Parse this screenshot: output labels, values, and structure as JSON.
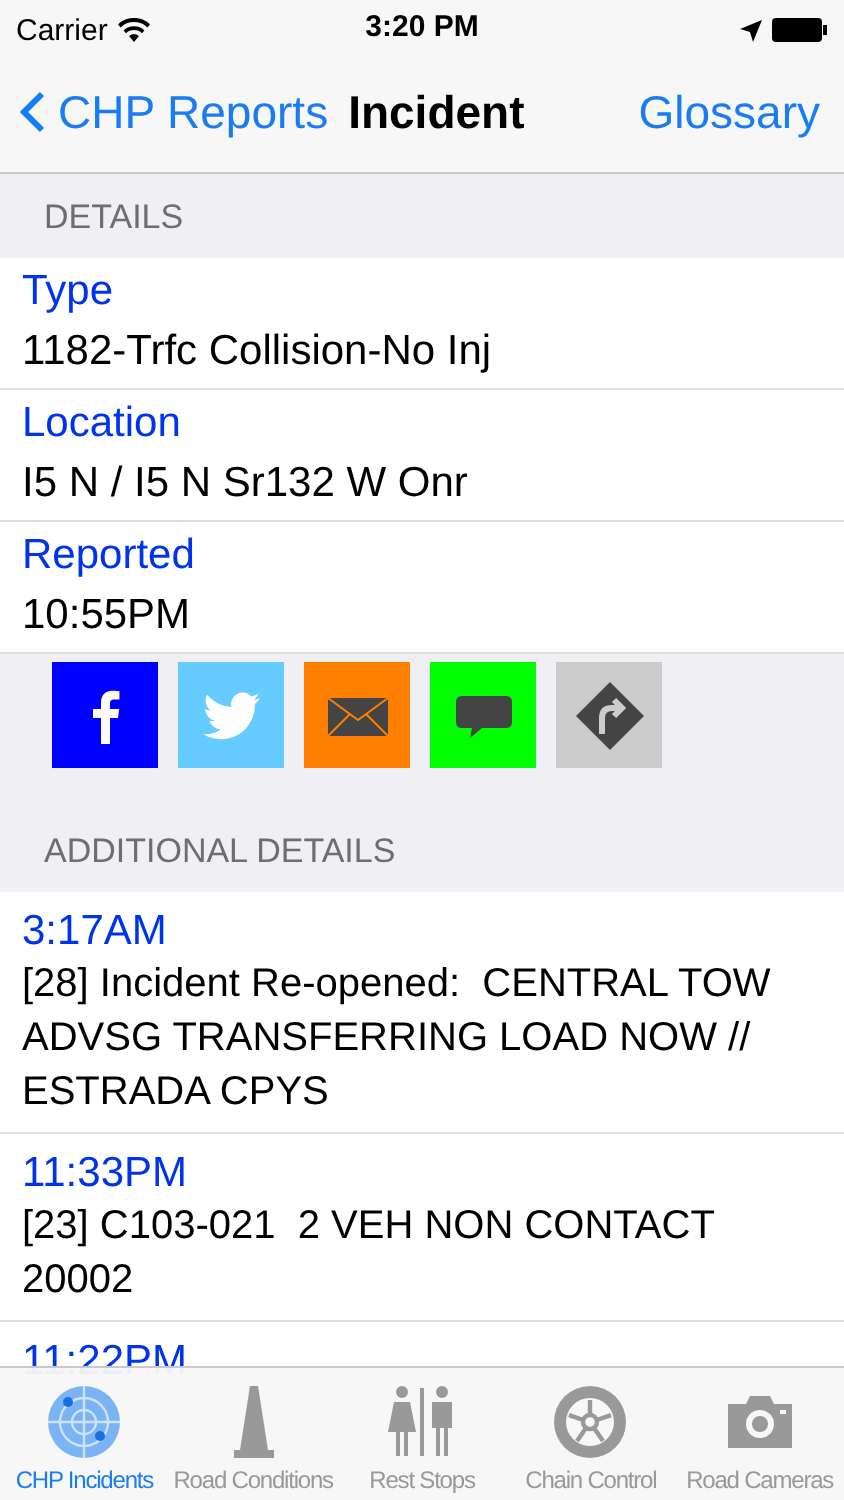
{
  "status_bar": {
    "carrier": "Carrier",
    "time": "3:20 PM"
  },
  "nav_bar": {
    "back": "CHP Reports",
    "title": "Incident",
    "action": "Glossary"
  },
  "details": {
    "header": "DETAILS",
    "fields": [
      {
        "label": "Type",
        "value": "1182-Trfc Collision-No Inj"
      },
      {
        "label": "Location",
        "value": "I5 N / I5 N Sr132 W Onr"
      },
      {
        "label": "Reported",
        "value": "10:55PM"
      }
    ]
  },
  "share_buttons": [
    {
      "kind": "facebook",
      "color": "#0000ff"
    },
    {
      "kind": "twitter",
      "color": "#66ccff"
    },
    {
      "kind": "email",
      "color": "#ff8000"
    },
    {
      "kind": "message",
      "color": "#00ff00"
    },
    {
      "kind": "directions",
      "color": "#cccccc"
    }
  ],
  "additional_details": {
    "header": "ADDITIONAL DETAILS",
    "entries": [
      {
        "time": "3:17AM",
        "text": "[28] Incident Re-opened:  CENTRAL TOW ADVSG TRANSFERRING LOAD NOW // ESTRADA CPYS"
      },
      {
        "time": "11:33PM",
        "text": "[23] C103-021  2 VEH NON CONTACT 20002"
      },
      {
        "time": "11:22PM"
      }
    ]
  },
  "tab_bar": [
    {
      "label": "CHP Incidents",
      "kind": "radar",
      "selected": true
    },
    {
      "label": "Road Conditions",
      "kind": "cone",
      "selected": false
    },
    {
      "label": "Rest Stops",
      "kind": "restroom",
      "selected": false
    },
    {
      "label": "Chain Control",
      "kind": "wheel",
      "selected": false
    },
    {
      "label": "Road Cameras",
      "kind": "camera",
      "selected": false
    }
  ]
}
